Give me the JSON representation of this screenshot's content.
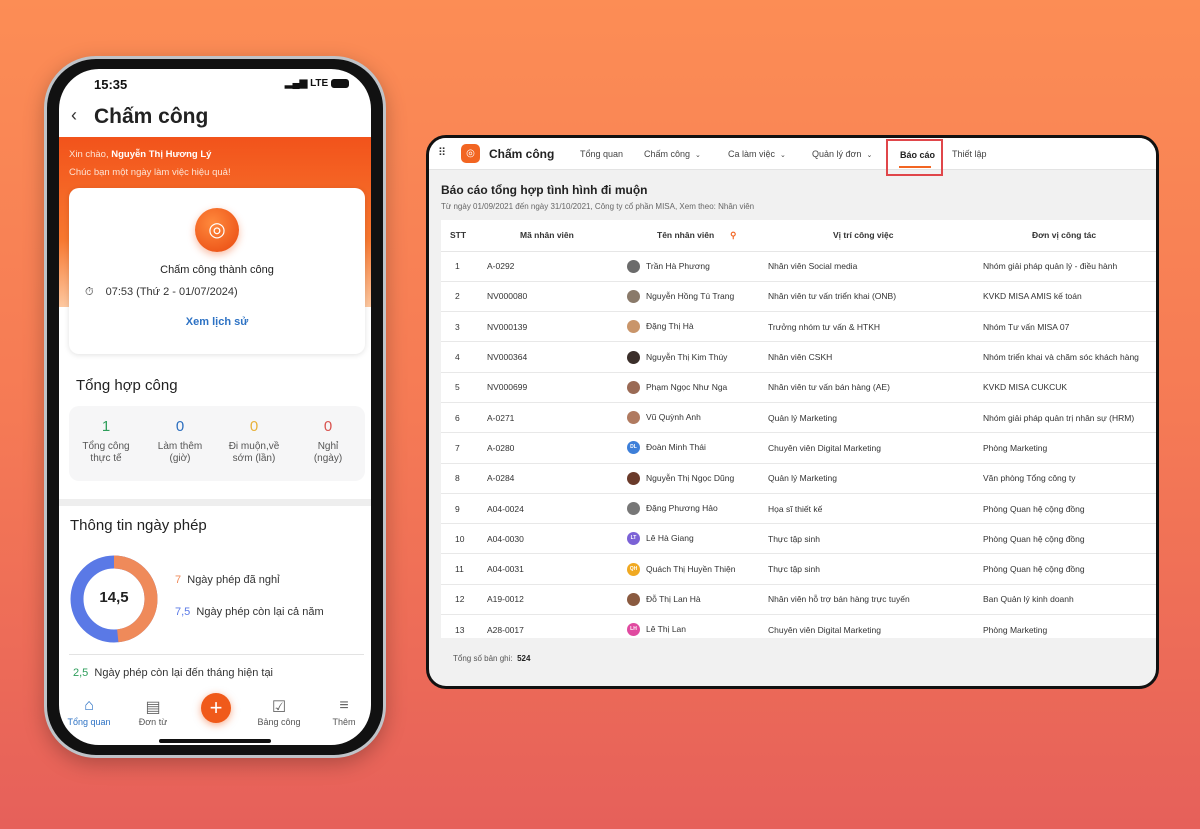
{
  "phone": {
    "status": {
      "time": "15:35",
      "network": "LTE"
    },
    "title": "Chấm công",
    "greeting_prefix": "Xin chào,",
    "user_name": "Nguyễn Thị Hương Lý",
    "wish": "Chúc bạn một ngày làm việc hiệu quả!",
    "checkin": {
      "status": "Chấm công thành công",
      "time": "07:53 (Thứ 2 - 01/07/2024)",
      "history_link": "Xem lịch sử"
    },
    "summary": {
      "title": "Tổng hợp công",
      "stats": [
        {
          "value": "1",
          "label1": "Tổng công",
          "label2": "thực tế",
          "color": "#2e9e5b"
        },
        {
          "value": "0",
          "label1": "Làm thêm",
          "label2": "(giờ)",
          "color": "#2d6fbf"
        },
        {
          "value": "0",
          "label1": "Đi muộn,về",
          "label2": "sớm (lần)",
          "color": "#e8b23b"
        },
        {
          "value": "0",
          "label1": "Nghỉ",
          "label2": "(ngày)",
          "color": "#d9534f"
        }
      ]
    },
    "leave": {
      "title": "Thông tin ngày phép",
      "total": "14,5",
      "used": {
        "value": "7",
        "label": "Ngày phép đã nghỉ",
        "color": "#ef8a5a"
      },
      "remaining_year": {
        "value": "7,5",
        "label": "Ngày phép còn lại cả năm",
        "color": "#5a79e6"
      },
      "remaining_month": {
        "value": "2,5",
        "label": "Ngày phép còn lại đến tháng hiện tại",
        "color": "#2e9e5b"
      }
    },
    "bottom_nav": [
      {
        "label": "Tổng quan",
        "icon": "home-icon"
      },
      {
        "label": "Đơn từ",
        "icon": "document-icon"
      },
      {
        "label": "",
        "icon": "plus-icon"
      },
      {
        "label": "Bảng công",
        "icon": "check-square-icon"
      },
      {
        "label": "Thêm",
        "icon": "menu-icon"
      }
    ]
  },
  "web": {
    "app_name": "Chấm công",
    "nav": [
      {
        "label": "Tổng quan"
      },
      {
        "label": "Chấm công",
        "dropdown": true
      },
      {
        "label": "Ca làm việc",
        "dropdown": true
      },
      {
        "label": "Quản lý đơn",
        "dropdown": true
      },
      {
        "label": "Báo cáo",
        "active": true
      },
      {
        "label": "Thiết lập"
      }
    ],
    "report_title": "Báo cáo tổng hợp tình hình đi muộn",
    "report_subtitle": "Từ ngày 01/09/2021 đến ngày 31/10/2021, Công ty cổ phần MISA, Xem theo: Nhân viên",
    "columns": [
      "STT",
      "Mã nhân viên",
      "Tên nhân viên",
      "Vị trí công việc",
      "Đơn vị công tác"
    ],
    "rows": [
      {
        "stt": "1",
        "code": "A-0292",
        "name": "Trần Hà Phương",
        "position": "Nhân viên Social media",
        "unit": "Nhóm giải pháp quản lý - điều hành",
        "avatar": "",
        "color": "#6b6b6b"
      },
      {
        "stt": "2",
        "code": "NV000080",
        "name": "Nguyễn Hồng Tú Trang",
        "position": "Nhân viên tư vấn triển khai (ONB)",
        "unit": "KVKD MISA AMIS kế toán",
        "avatar": "",
        "color": "#8a7a6a"
      },
      {
        "stt": "3",
        "code": "NV000139",
        "name": "Đặng Thị Hà",
        "position": "Trưởng nhóm tư vấn & HTKH",
        "unit": "Nhóm Tư vấn MISA 07",
        "avatar": "",
        "color": "#c9956a"
      },
      {
        "stt": "4",
        "code": "NV000364",
        "name": "Nguyễn Thị Kim Thúy",
        "position": "Nhân viên CSKH",
        "unit": "Nhóm triển khai và chăm sóc khách hàng",
        "avatar": "",
        "color": "#3a2e2a"
      },
      {
        "stt": "5",
        "code": "NV000699",
        "name": "Phạm Ngọc Như Nga",
        "position": "Nhân viên tư vấn bán hàng (AE)",
        "unit": "KVKD MISA CUKCUK",
        "avatar": "",
        "color": "#9a6a55"
      },
      {
        "stt": "6",
        "code": "A-0271",
        "name": "Vũ Quỳnh Anh",
        "position": "Quản lý Marketing",
        "unit": "Nhóm giải pháp quản trị nhân sự (HRM)",
        "avatar": "",
        "color": "#b07a60"
      },
      {
        "stt": "7",
        "code": "A-0280",
        "name": "Đoàn Minh Thái",
        "position": "Chuyên viên Digital Marketing",
        "unit": "Phòng Marketing",
        "avatar": "DL",
        "color": "#3d7fd9"
      },
      {
        "stt": "8",
        "code": "A-0284",
        "name": "Nguyễn Thị Ngọc Dũng",
        "position": "Quản lý Marketing",
        "unit": "Văn phòng Tổng công ty",
        "avatar": "",
        "color": "#6a3a2a"
      },
      {
        "stt": "9",
        "code": "A04-0024",
        "name": "Đặng Phương Hảo",
        "position": "Họa sĩ thiết kế",
        "unit": "Phòng Quan hệ cộng đồng",
        "avatar": "",
        "color": "#777"
      },
      {
        "stt": "10",
        "code": "A04-0030",
        "name": "Lê Hà Giang",
        "position": "Thực tập sinh",
        "unit": "Phòng Quan hệ cộng đồng",
        "avatar": "LT",
        "color": "#7b62d6"
      },
      {
        "stt": "11",
        "code": "A04-0031",
        "name": "Quách Thị Huyền Thiện",
        "position": "Thực tập sinh",
        "unit": "Phòng Quan hệ cộng đồng",
        "avatar": "QH",
        "color": "#f0a922"
      },
      {
        "stt": "12",
        "code": "A19-0012",
        "name": "Đỗ Thị Lan Hà",
        "position": "Nhân viên hỗ trợ bán hàng trực tuyến",
        "unit": "Ban Quản lý kinh doanh",
        "avatar": "",
        "color": "#8a5a40"
      },
      {
        "stt": "13",
        "code": "A28-0017",
        "name": "Lê Thị Lan",
        "position": "Chuyên viên Digital Marketing",
        "unit": "Phòng Marketing",
        "avatar": "LH",
        "color": "#e04aa0"
      }
    ],
    "total_label": "Tổng số bản ghi:",
    "total_value": "524",
    "accent": "#f26522"
  }
}
